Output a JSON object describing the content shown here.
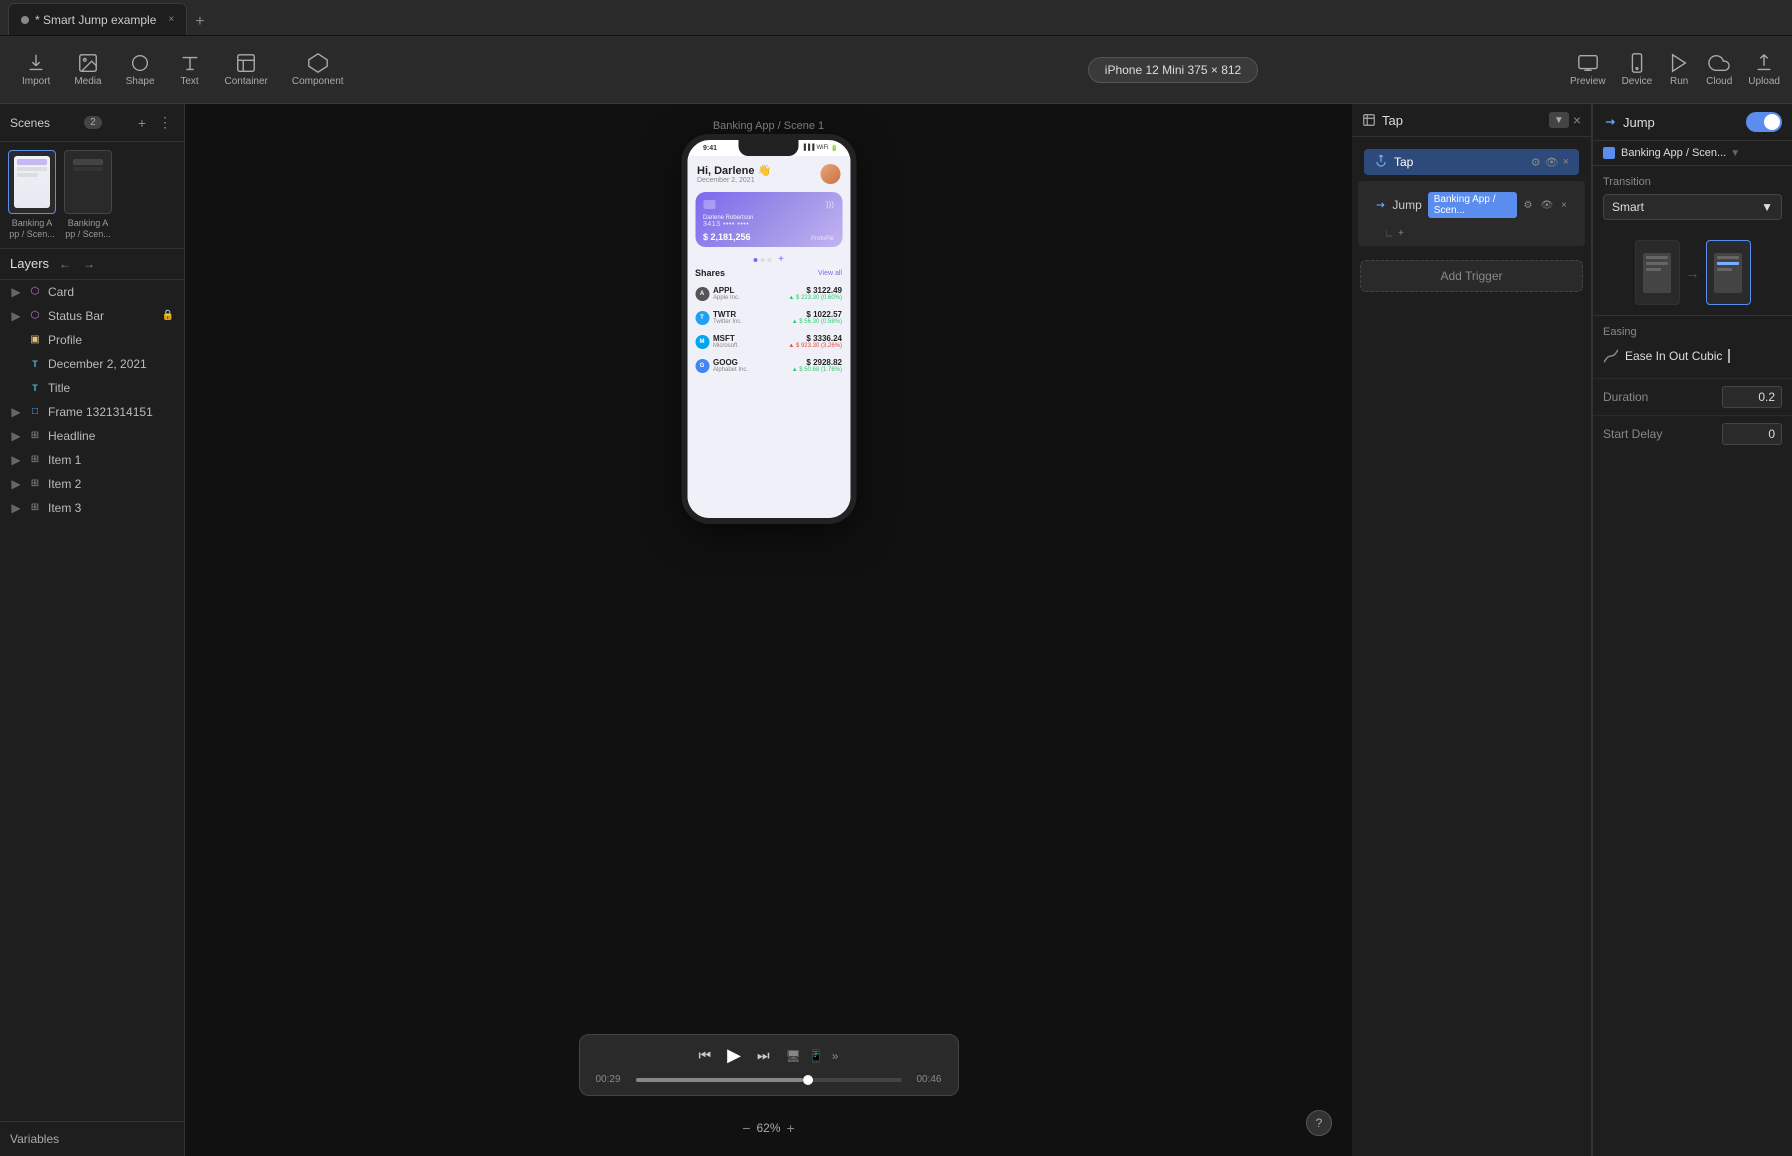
{
  "app": {
    "title": "* Smart Jump example",
    "tab_close": "×",
    "tab_new": "+"
  },
  "toolbar": {
    "import_label": "Import",
    "media_label": "Media",
    "shape_label": "Shape",
    "text_label": "Text",
    "container_label": "Container",
    "component_label": "Component",
    "preview_label": "Preview",
    "device_label": "Device",
    "run_label": "Run",
    "cloud_label": "Cloud",
    "upload_label": "Upload"
  },
  "device_badge": "iPhone 12 Mini  375 × 812",
  "scenes": {
    "title": "Scenes",
    "count": "2",
    "items": [
      {
        "label": "Banking A\npp / Scen..."
      },
      {
        "label": "Banking A\npp / Scen..."
      }
    ]
  },
  "layers": {
    "title": "Layers",
    "items": [
      {
        "name": "Card",
        "type": "component",
        "indent": 0
      },
      {
        "name": "Status Bar",
        "type": "component",
        "indent": 0,
        "locked": true
      },
      {
        "name": "Profile",
        "type": "image",
        "indent": 0
      },
      {
        "name": "December 2, 2021",
        "type": "text",
        "indent": 0
      },
      {
        "name": "Title",
        "type": "text",
        "indent": 0
      },
      {
        "name": "Frame 1321314151",
        "type": "frame",
        "indent": 0
      },
      {
        "name": "Headline",
        "type": "group",
        "indent": 0
      },
      {
        "name": "Item 1",
        "type": "group",
        "indent": 0
      },
      {
        "name": "Item 2",
        "type": "group",
        "indent": 0
      },
      {
        "name": "Item 3",
        "type": "group",
        "indent": 0
      }
    ]
  },
  "variables": {
    "title": "Variables"
  },
  "canvas": {
    "scene_label": "Banking App / Scene 1",
    "zoom_level": "62%",
    "zoom_minus": "−",
    "zoom_plus": "+"
  },
  "phone": {
    "status_time": "9:41",
    "greeting": "Hi, Darlene 👋",
    "date": "December 2, 2021",
    "card_name": "Darlene Robertson",
    "card_number": "3413 •••• ••••",
    "card_balance": "$ 2,181,256",
    "card_brand": "ProtoPie",
    "shares_title": "Shares",
    "shares_viewall": "View all",
    "stocks": [
      {
        "ticker": "APPL",
        "company": "Apple Inc.",
        "price": "$ 3122.49",
        "change": "▲ $ 223.30 (0.60%)",
        "positive": true,
        "color": "#555"
      },
      {
        "ticker": "TWTR",
        "company": "Twitter Inc.",
        "price": "$ 1022.57",
        "change": "▲ $ 56.30 (0.58%)",
        "positive": true,
        "color": "#1DA1F2"
      },
      {
        "ticker": "MSFT",
        "company": "Microsoft",
        "price": "$ 3336.24",
        "change": "▲ $ 923.30 (3.26%)",
        "positive": false,
        "color": "#00a4ef"
      },
      {
        "ticker": "GOOG",
        "company": "Alphabet Inc.",
        "price": "$ 2928.82",
        "change": "▲ $ 50.68 (1.76%)",
        "positive": true,
        "color": "#4285f4"
      }
    ]
  },
  "timeline": {
    "time_start": "00:29",
    "time_end": "00:46",
    "progress": 63
  },
  "interaction": {
    "panel_title": "Tap",
    "jump_label": "Jump",
    "destination": "Banking App / Scen...",
    "add_trigger": "Add Trigger"
  },
  "right_panel": {
    "title": "Jump",
    "toggle_on": true,
    "destination_label": "Banking App / Scen...",
    "transition_label": "Transition",
    "transition_value": "Smart",
    "easing_label": "Easing",
    "easing_value": "Ease In Out Cubic",
    "duration_label": "Duration",
    "duration_value": "0.2",
    "start_delay_label": "Start Delay",
    "start_delay_value": "0"
  }
}
